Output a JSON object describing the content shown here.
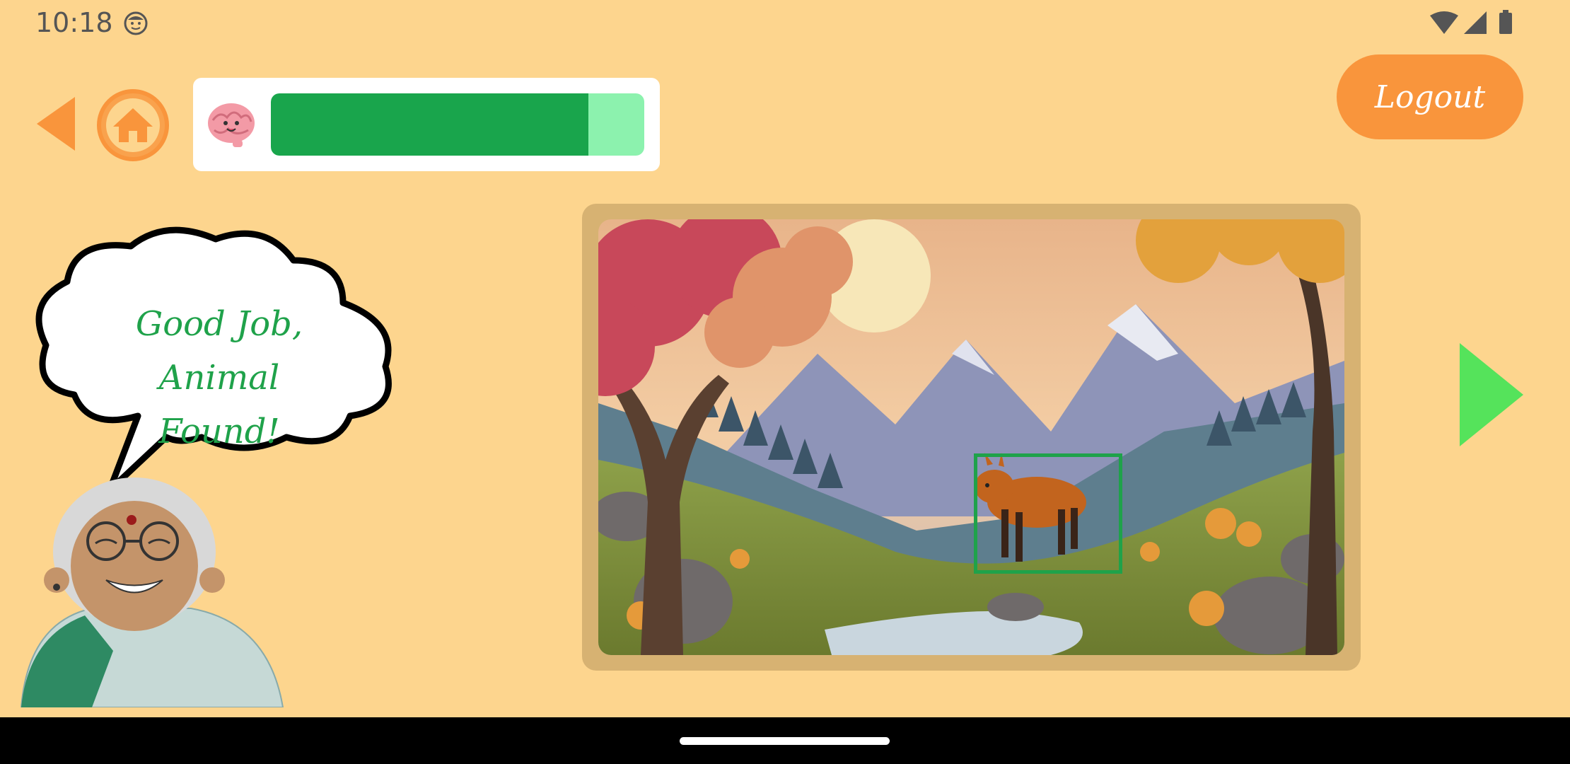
{
  "status_bar": {
    "time": "10:18",
    "icons": [
      "face-notification-icon",
      "wifi-icon",
      "cell-signal-icon",
      "battery-icon"
    ]
  },
  "top_bar": {
    "back_icon": "back-triangle-icon",
    "home_icon": "home-icon",
    "mascot_icon": "brain-icon",
    "progress": 0.85,
    "logout_label": "Logout"
  },
  "scene": {
    "image_description_icon": "mountain-landscape-with-animal",
    "found_highlight_color": "#1FA24A"
  },
  "character": {
    "speech": "Good Job, Animal Found!",
    "speech_line1": "Good Job, Animal",
    "speech_line2": "Found!"
  },
  "navigation": {
    "next_icon": "next-triangle-icon"
  },
  "colors": {
    "background": "#FDD58E",
    "accent_orange": "#F9953C",
    "progress_fill": "#19A54C",
    "progress_track": "#8CF2AE",
    "next_green": "#55E35B",
    "speech_green": "#1FA24A"
  }
}
